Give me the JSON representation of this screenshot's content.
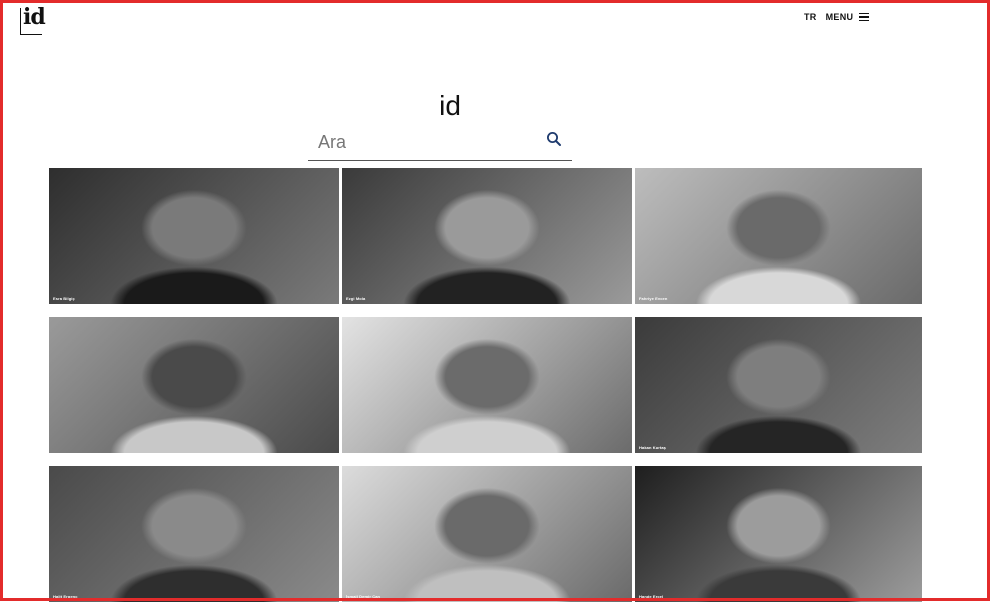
{
  "header": {
    "logo_text": "id",
    "language": "TR",
    "menu_label": "MENU"
  },
  "hero": {
    "title": "id"
  },
  "search": {
    "placeholder": "Ara"
  },
  "talents": [
    {
      "name": "Esra Bilgiç",
      "tone": [
        "#2e2e2e",
        "#7a7a7a",
        "#1a1a1a"
      ]
    },
    {
      "name": "Ezgi Mola",
      "tone": [
        "#3a3a3a",
        "#9a9a9a",
        "#222222"
      ]
    },
    {
      "name": "Fahriye Evcen",
      "tone": [
        "#bdbdbd",
        "#6a6a6a",
        "#d8d8d8"
      ]
    },
    {
      "name": "",
      "tone": [
        "#9a9a9a",
        "#4a4a4a",
        "#c8c8c8"
      ]
    },
    {
      "name": "",
      "tone": [
        "#e3e3e3",
        "#6b6b6b",
        "#cfcfcf"
      ]
    },
    {
      "name": "Hakan Kurtaş",
      "tone": [
        "#3b3b3b",
        "#7e7e7e",
        "#252525"
      ]
    },
    {
      "name": "Halit Ergenç",
      "tone": [
        "#4a4a4a",
        "#8a8a8a",
        "#2e2e2e"
      ]
    },
    {
      "name": "İsmail Demir Can",
      "tone": [
        "#dcdcdc",
        "#6a6a6a",
        "#bfbfbf"
      ]
    },
    {
      "name": "Hande Erçel",
      "tone": [
        "#1e1e1e",
        "#9c9c9c",
        "#3a3a3a"
      ]
    }
  ]
}
